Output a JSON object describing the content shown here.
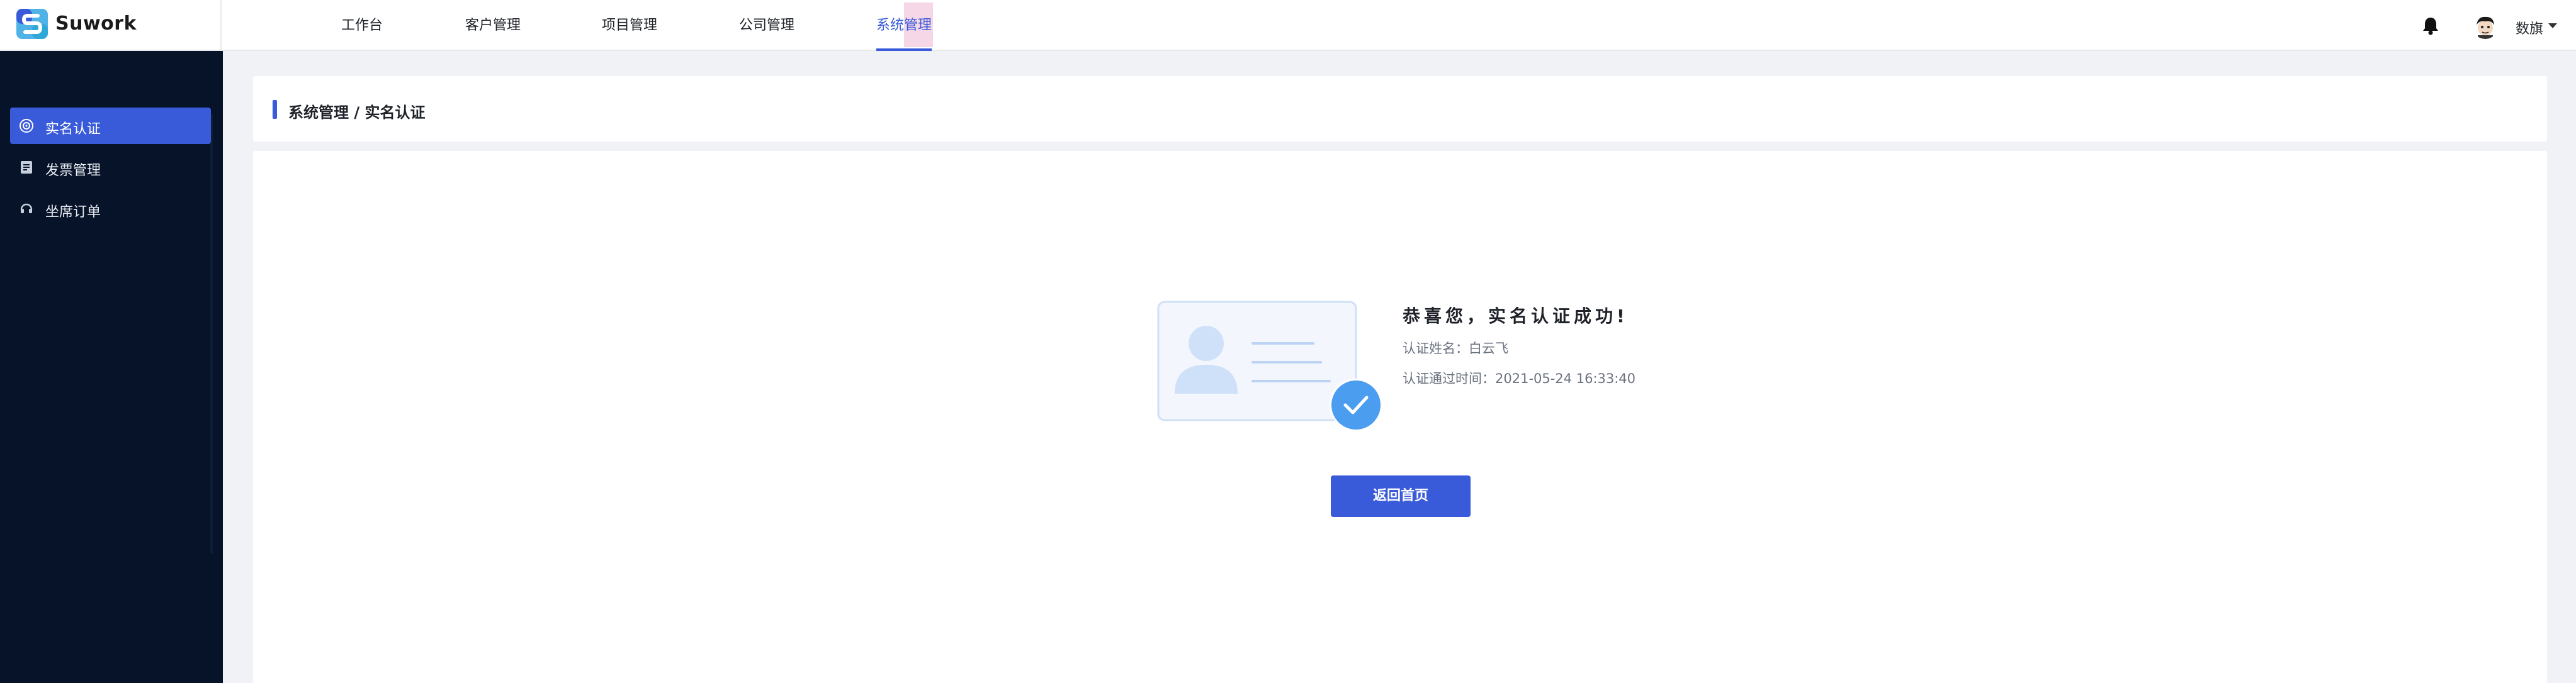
{
  "app": {
    "name": "Suwork",
    "brand_color": "#3a5bd9",
    "sidebar_bg": "#061328"
  },
  "header": {
    "nav": [
      {
        "label": "工作台"
      },
      {
        "label": "客户管理"
      },
      {
        "label": "项目管理"
      },
      {
        "label": "公司管理"
      },
      {
        "label": "系统管理",
        "active": true
      }
    ],
    "user_name": "数旗",
    "icons": [
      "bell-icon",
      "avatar",
      "caret-down-icon"
    ]
  },
  "sidebar": {
    "items": [
      {
        "label": "实名认证",
        "icon": "verify-icon",
        "active": true
      },
      {
        "label": "发票管理",
        "icon": "invoice-icon"
      },
      {
        "label": "坐席订单",
        "icon": "seat-order-icon"
      }
    ]
  },
  "breadcrumb": {
    "text": "系统管理 / 实名认证"
  },
  "result": {
    "title": "恭喜您，实名认证成功!",
    "name_line": "认证姓名：白云飞",
    "time_line": "认证通过时间：2021-05-24 16:33:40",
    "button_label": "返回首页"
  }
}
